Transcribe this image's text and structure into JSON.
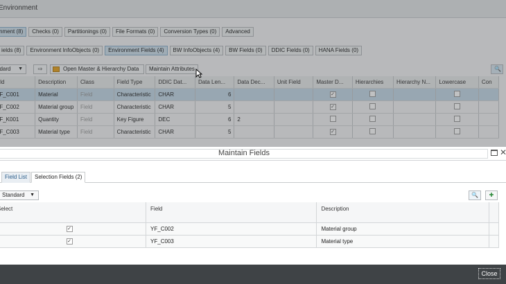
{
  "app": {
    "title": "Environment",
    "tabs_row1": [
      "nment (8)",
      "Checks (0)",
      "Partitionings (0)",
      "File Formats (0)",
      "Conversion Types (0)",
      "Advanced"
    ],
    "tabs_row2": [
      "ields (8)",
      "Environment InfoObjects (0)",
      "Environment Fields (4)",
      "BW InfoObjects (4)",
      "BW Fields (0)",
      "DDIC Fields (0)",
      "HANA Fields (0)"
    ],
    "active_tab_row1": 0,
    "active_tab_row2": 2,
    "toolbar": {
      "variant": "ndard",
      "open_master": "Open Master & Hierarchy Data",
      "maintain": "Maintain Attributes"
    },
    "table": {
      "columns": [
        "ield",
        "Description",
        "Class",
        "Field Type",
        "DDIC Dat...",
        "Data Len...",
        "Data Dec...",
        "Unit Field",
        "Master D...",
        "Hierarchies",
        "Hierarchy N...",
        "Lowercase",
        "Con"
      ],
      "rows": [
        {
          "field": "YF_C001",
          "description": "Material",
          "class": "Field",
          "type": "Characteristic",
          "ddic": "CHAR",
          "len": "6",
          "dec": "",
          "master": true
        },
        {
          "field": "YF_C002",
          "description": "Material group",
          "class": "Field",
          "type": "Characteristic",
          "ddic": "CHAR",
          "len": "5",
          "dec": "",
          "master": true
        },
        {
          "field": "YF_K001",
          "description": "Quantity",
          "class": "Field",
          "type": "Key Figure",
          "ddic": "DEC",
          "len": "6",
          "dec": "2",
          "master": false
        },
        {
          "field": "YF_C003",
          "description": "Material type",
          "class": "Field",
          "type": "Characteristic",
          "ddic": "CHAR",
          "len": "5",
          "dec": "",
          "master": true
        }
      ]
    }
  },
  "dialog": {
    "title": "Maintain Fields",
    "tabs": [
      "Field List",
      "Selection Fields (2)"
    ],
    "variant": "Standard",
    "columns": [
      "Select",
      "Field",
      "Description"
    ],
    "rows": [
      {
        "selected": true,
        "field": "YF_C002",
        "description": "Material group"
      },
      {
        "selected": true,
        "field": "YF_C003",
        "description": "Material type"
      }
    ],
    "close_label": "Close"
  },
  "colors": {
    "footer": "#3f4346",
    "selected_row": "#c5d9e7"
  }
}
